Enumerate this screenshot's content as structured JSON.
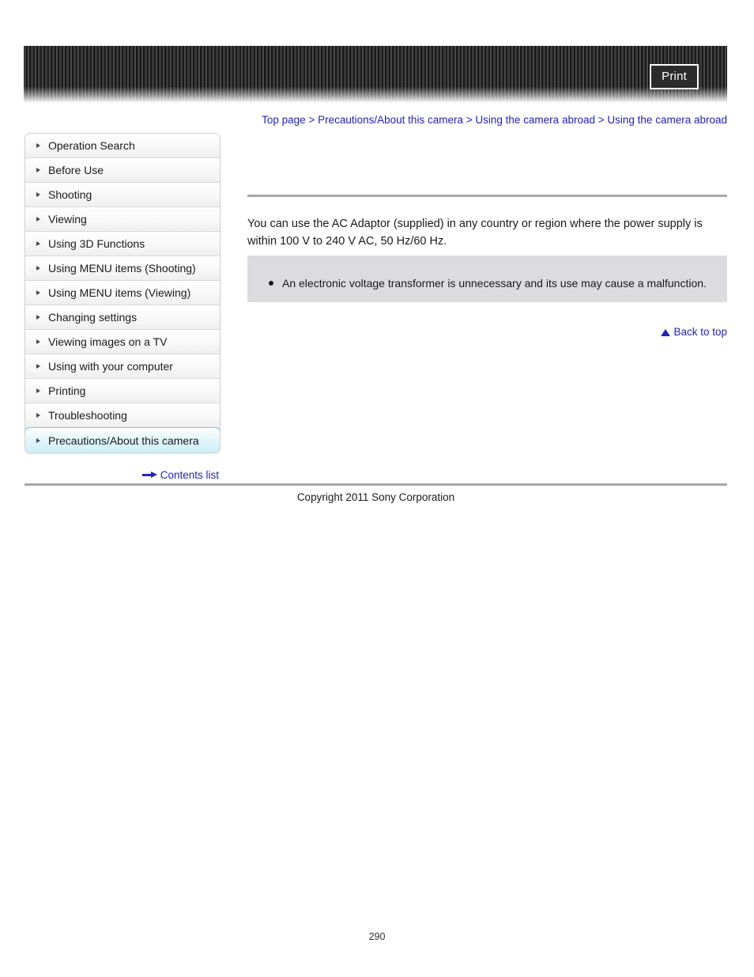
{
  "header": {
    "print_label": "Print"
  },
  "breadcrumb": {
    "separator": ">",
    "items": [
      "Top page",
      "Precautions/About this camera",
      "Using the camera abroad",
      "Using the camera abroad"
    ]
  },
  "sidebar": {
    "items": [
      {
        "label": "Operation Search",
        "active": false
      },
      {
        "label": "Before Use",
        "active": false
      },
      {
        "label": "Shooting",
        "active": false
      },
      {
        "label": "Viewing",
        "active": false
      },
      {
        "label": "Using 3D Functions",
        "active": false
      },
      {
        "label": "Using MENU items (Shooting)",
        "active": false
      },
      {
        "label": "Using MENU items (Viewing)",
        "active": false
      },
      {
        "label": "Changing settings",
        "active": false
      },
      {
        "label": "Viewing images on a TV",
        "active": false
      },
      {
        "label": "Using with your computer",
        "active": false
      },
      {
        "label": "Printing",
        "active": false
      },
      {
        "label": "Troubleshooting",
        "active": false
      },
      {
        "label": "Precautions/About this camera",
        "active": true
      }
    ],
    "contents_list_label": "Contents list"
  },
  "main": {
    "body_text": "You can use the AC Adaptor (supplied) in any country or region where the power supply is within 100 V to 240 V AC, 50 Hz/60 Hz.",
    "note_items": [
      "An electronic voltage transformer is unnecessary and its use may cause a malfunction."
    ],
    "back_to_top_label": "Back to top"
  },
  "footer": {
    "copyright": "Copyright 2011 Sony Corporation",
    "page_number": "290"
  },
  "colors": {
    "link_blue": "#2222bb",
    "rule_gray": "#a8a8a8",
    "note_bg": "#dcdcdf",
    "active_border": "#7fc8dd"
  }
}
